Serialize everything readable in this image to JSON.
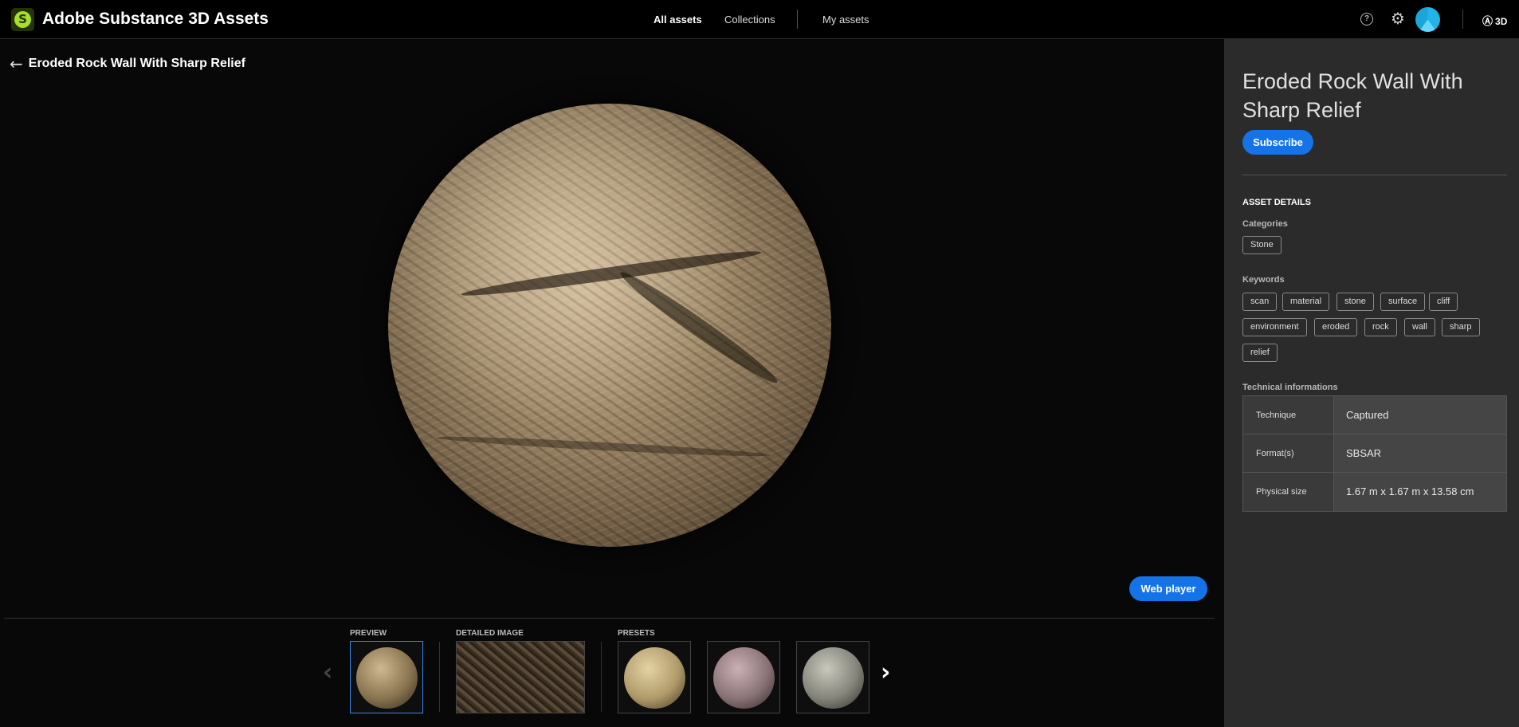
{
  "header": {
    "app_title": "Adobe Substance 3D Assets",
    "logo_letter": "S",
    "nav": [
      {
        "label": "All assets",
        "active": true
      },
      {
        "label": "Collections",
        "active": false
      },
      {
        "label": "My assets",
        "active": false
      }
    ],
    "help_glyph": "?",
    "adobe_mark": "3D",
    "icons": [
      "help-icon",
      "gear-icon",
      "avatar",
      "adobe-logo"
    ]
  },
  "viewer": {
    "back_icon": "arrow-left-icon",
    "asset_name": "Eroded Rock Wall With Sharp Relief",
    "web_player_label": "Web player",
    "sections": {
      "preview": "PREVIEW",
      "detailed_image": "DETAILED IMAGE",
      "presets": "PRESETS"
    },
    "thumbnails": [
      {
        "section": "preview",
        "selected": true,
        "tone": "tan"
      },
      {
        "section": "detailed_image",
        "selected": false,
        "tone": "brown"
      },
      {
        "section": "presets",
        "selected": false,
        "tone": "beige"
      },
      {
        "section": "presets",
        "selected": false,
        "tone": "mauve"
      },
      {
        "section": "presets",
        "selected": false,
        "tone": "grey"
      }
    ],
    "prev_icon": "chevron-left-icon",
    "next_icon": "chevron-right-icon"
  },
  "panel": {
    "title": "Eroded Rock Wall With Sharp Relief",
    "subscribe_label": "Subscribe",
    "asset_details_heading": "ASSET DETAILS",
    "categories_label": "Categories",
    "categories": [
      "Stone"
    ],
    "keywords_label": "Keywords",
    "keywords": [
      "scan",
      "material",
      "stone",
      "surface",
      "cliff",
      "environment",
      "eroded",
      "rock",
      "wall",
      "sharp",
      "relief"
    ],
    "technical_label": "Technical informations",
    "technical": [
      {
        "key": "Technique",
        "value": "Captured"
      },
      {
        "key": "Format(s)",
        "value": "SBSAR"
      },
      {
        "key": "Physical size",
        "value": "1.67 m x 1.67 m x 13.58 cm"
      }
    ]
  },
  "colors": {
    "accent_blue": "#1473e6",
    "panel_bg": "#2b2b2b",
    "logo_green": "#a6e02b"
  }
}
